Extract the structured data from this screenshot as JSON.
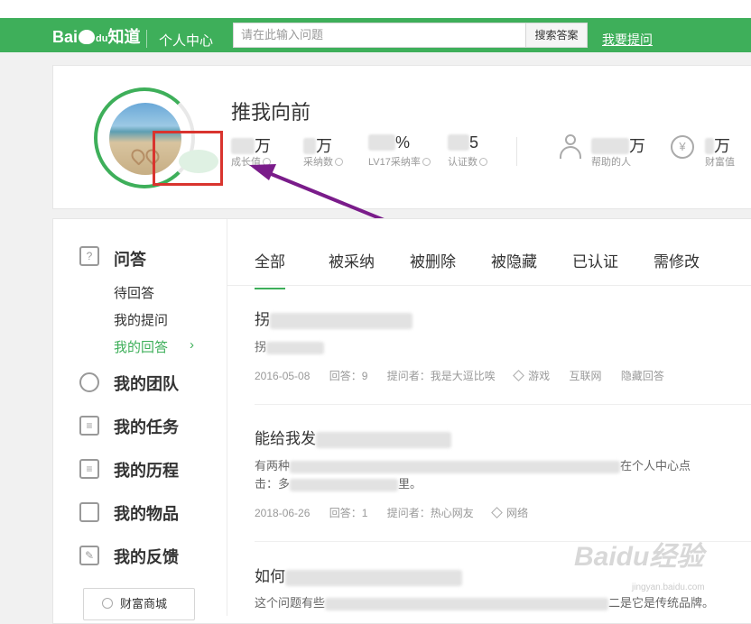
{
  "header": {
    "logo_text": "Bai知道",
    "logo_du": "du",
    "title": "个人中心",
    "search_placeholder": "请在此输入问题",
    "search_button": "搜索答案",
    "ask_link": "我要提问"
  },
  "profile": {
    "username": "推我向前",
    "stats": [
      {
        "value": "万",
        "label": "成长值"
      },
      {
        "value": "万",
        "label": "采纳数"
      },
      {
        "value": "%",
        "label": "LV17采纳率"
      },
      {
        "value": "5",
        "label": "认证数"
      }
    ],
    "helped": {
      "value": "万",
      "label": "帮助的人"
    },
    "wealth": {
      "value": "万",
      "label": "财富值"
    },
    "wealth_icon": "¥"
  },
  "sidebar": {
    "qa_title": "问答",
    "qa_items": [
      "待回答",
      "我的提问",
      "我的回答"
    ],
    "active_item": "我的回答",
    "sections": [
      "我的团队",
      "我的任务",
      "我的历程",
      "我的物品",
      "我的反馈"
    ],
    "mall_button": "财富商城"
  },
  "tabs": [
    "全部",
    "被采纳",
    "被删除",
    "被隐藏",
    "已认证",
    "需修改"
  ],
  "active_tab": "全部",
  "questions": [
    {
      "title_visible": "拐",
      "excerpt_visible": "拐",
      "date": "2016-05-08",
      "answers": "回答：9",
      "asker": "提问者：我是大逗比唉",
      "tags": [
        "游戏",
        "互联网"
      ],
      "status": "隐藏回答"
    },
    {
      "title_visible": "能给我发",
      "excerpt_start": "有两种",
      "excerpt_mid": "在个人中心点",
      "excerpt_line2_start": "击：多",
      "excerpt_line2_end": "里。",
      "date": "2018-06-26",
      "answers": "回答：1",
      "asker": "提问者：热心网友",
      "tags": [
        "网络"
      ]
    },
    {
      "title_visible": "如何",
      "excerpt_start": "这个问题有些",
      "excerpt_end": "二是它是传统品牌。"
    }
  ],
  "watermark": {
    "main": "Baidu经验",
    "sub": "jingyan.baidu.com"
  }
}
